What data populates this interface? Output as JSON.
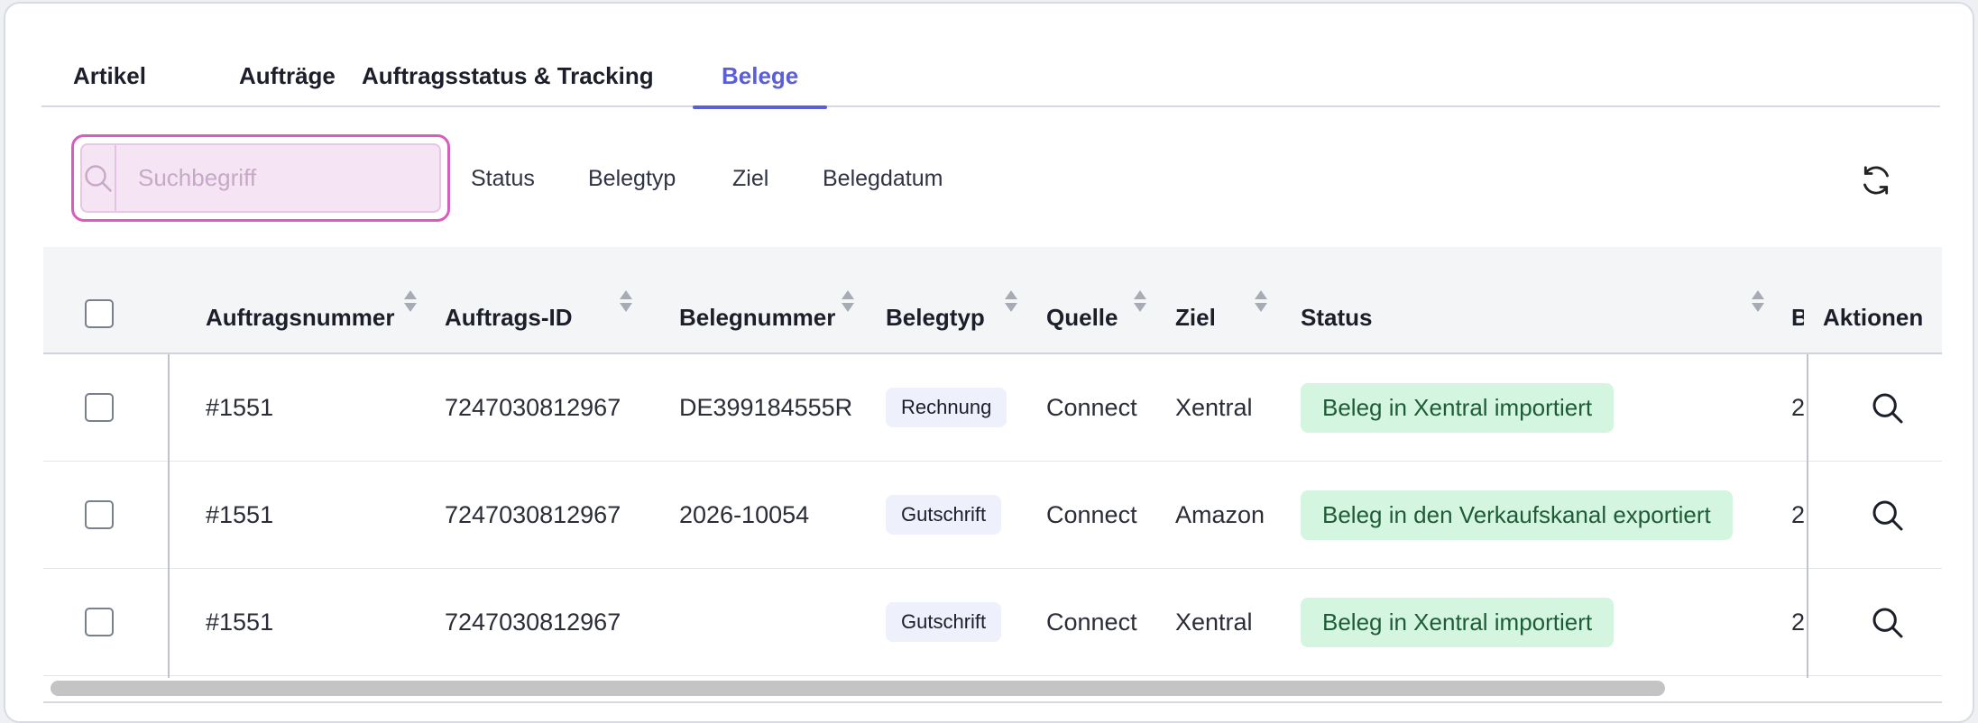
{
  "tabs": [
    {
      "label": "Artikel"
    },
    {
      "label": "Aufträge"
    },
    {
      "label": "Auftragsstatus & Tracking"
    },
    {
      "label": "Belege",
      "active": true
    }
  ],
  "search": {
    "placeholder": "Suchbegriff",
    "value": ""
  },
  "filters": [
    {
      "label": "Status"
    },
    {
      "label": "Belegtyp"
    },
    {
      "label": "Ziel"
    },
    {
      "label": "Belegdatum"
    }
  ],
  "table": {
    "columns": [
      "Auftragsnummer",
      "Auftrags-ID",
      "Belegnummer",
      "Belegtyp",
      "Quelle",
      "Ziel",
      "Status",
      "B",
      "Aktionen"
    ],
    "rows": [
      {
        "auftragsnummer": "#1551",
        "auftrags_id": "7247030812967",
        "belegnummer": "DE399184555R",
        "belegtyp": "Rechnung",
        "quelle": "Connect",
        "ziel": "Xentral",
        "status": "Beleg in Xentral importiert",
        "b": "2"
      },
      {
        "auftragsnummer": "#1551",
        "auftrags_id": "7247030812967",
        "belegnummer": "2026-10054",
        "belegtyp": "Gutschrift",
        "quelle": "Connect",
        "ziel": "Amazon",
        "status": "Beleg in den Verkaufskanal exportiert",
        "b": "2"
      },
      {
        "auftragsnummer": "#1551",
        "auftrags_id": "7247030812967",
        "belegnummer": "",
        "belegtyp": "Gutschrift",
        "quelle": "Connect",
        "ziel": "Xentral",
        "status": "Beleg in Xentral importiert",
        "b": "2"
      }
    ]
  },
  "colors": {
    "accent": "#5b5fd6",
    "status_bg": "#d4f6e0",
    "status_text": "#1e5c37",
    "search_border": "#d85cc0"
  },
  "icons": {
    "search": "search-icon",
    "refresh": "refresh-icon",
    "view": "magnifier-icon",
    "sort": "sort-icon"
  }
}
